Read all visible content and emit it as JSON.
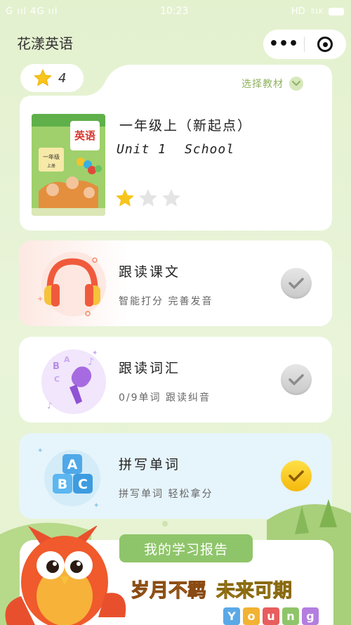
{
  "status_bar": {
    "network_left": "G ııl 4G ııl",
    "time": "10:23",
    "right": "HD",
    "speed": "51K"
  },
  "nav": {
    "title": "花漾英语",
    "more_icon": "more-dots-icon",
    "close_icon": "target-icon"
  },
  "score": {
    "count": "4",
    "icon": "star-icon"
  },
  "book": {
    "select_label": "选择教材",
    "title": "一年级上（新起点）",
    "unit": "Unit 1",
    "unit_name": "School",
    "cover_text": "英语",
    "cover_grade": "一年级",
    "cover_volume": "上册",
    "stars_earned": 1,
    "stars_total": 3
  },
  "activities": [
    {
      "title": "跟读课文",
      "subtitle": "智能打分  完善发音",
      "icon": "headphones-icon",
      "done": false
    },
    {
      "title": "跟读词汇",
      "subtitle": "0/9单词  跟读纠音",
      "icon": "microphone-icon",
      "done": false
    },
    {
      "title": "拼写单词",
      "subtitle": "拼写单词  轻松拿分",
      "icon": "abc-blocks-icon",
      "done": true
    }
  ],
  "report": {
    "tab_label": "我的学习报告",
    "slogan_1": "岁月不羁",
    "slogan_2": "未来可期",
    "young_letters": [
      "Y",
      "o",
      "u",
      "n",
      "g"
    ],
    "young_colors": [
      "#5aa9e6",
      "#f2b233",
      "#e85d5d",
      "#8fc56a",
      "#b37ee0"
    ]
  },
  "colors": {
    "accent_green": "#8fc56a",
    "check_yellow": "#f5b80c",
    "star_yellow": "#f7c51b"
  }
}
